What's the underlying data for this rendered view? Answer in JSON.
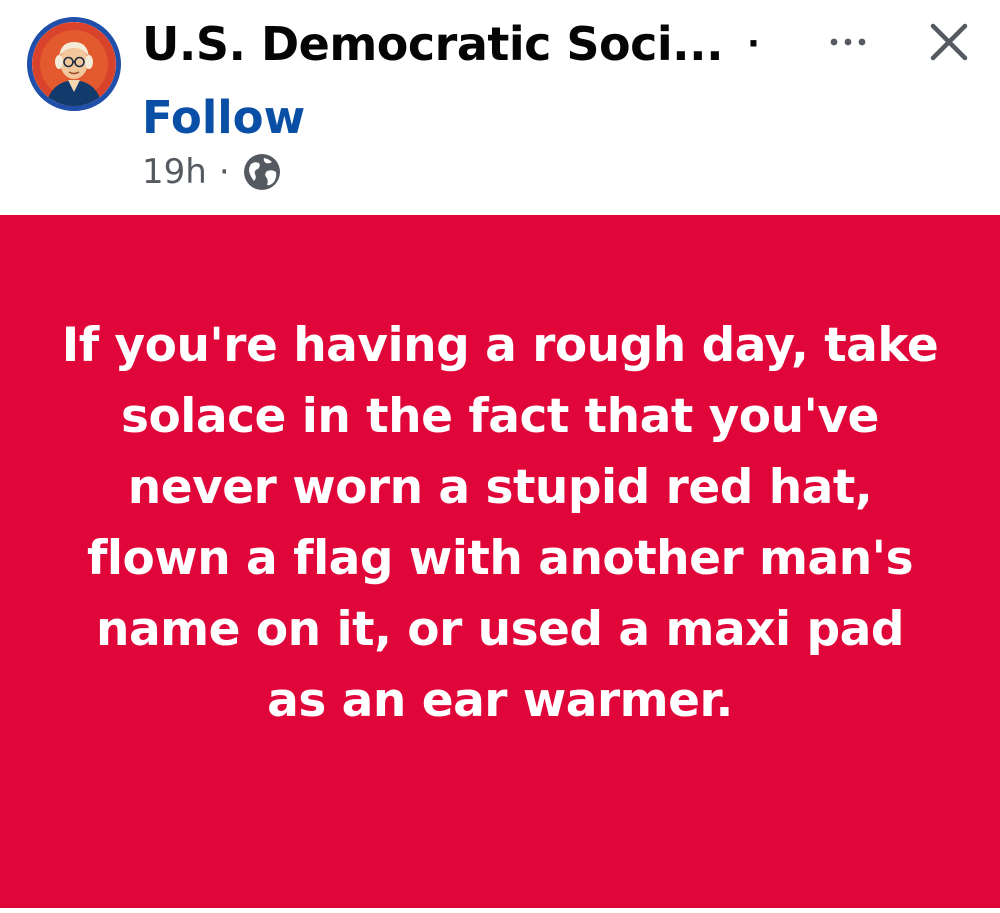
{
  "post": {
    "page_name": "U.S. Democratic Soci...",
    "name_separator": "·",
    "follow_label": "Follow",
    "timestamp": "19h",
    "meta_separator": "·",
    "audience_icon": "globe-icon",
    "body_text": "If you're having a rough day, take solace in the fact that you've never worn a stupid red hat, flown a flag with another man's name on it, or used a maxi pad as an ear warmer."
  },
  "icons": {
    "more": "more-options-icon",
    "close": "close-icon"
  },
  "colors": {
    "post_background": "#e0063a",
    "post_text": "#ffffff",
    "follow_link": "#0a4fa6",
    "avatar_ring": "#1f4fa8",
    "meta_text": "#555a60"
  }
}
